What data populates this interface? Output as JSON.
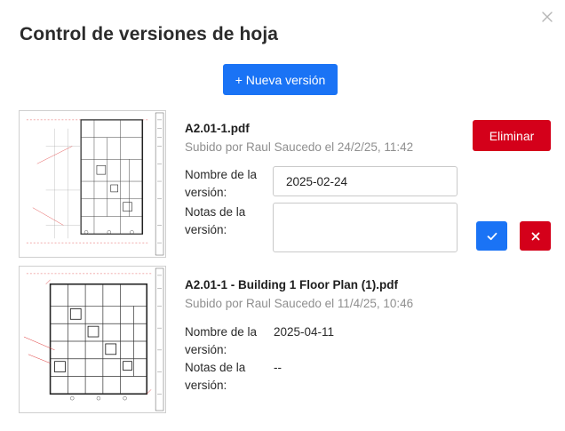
{
  "dialog": {
    "title": "Control de versiones de hoja",
    "new_version_label": "+ Nueva versión",
    "close_icon": "close-icon"
  },
  "versions": [
    {
      "filename": "A2.01-1.pdf",
      "uploaded": "Subido por Raul Saucedo el 24/2/25, 11:42",
      "name_label": "Nombre de la versión:",
      "name_value": "2025-02-24",
      "notes_label": "Notas de la versión:",
      "notes_value": "",
      "delete_label": "Eliminar",
      "editing": true
    },
    {
      "filename": "A2.01-1 - Building 1 Floor Plan (1).pdf",
      "uploaded": "Subido por Raul Saucedo el 11/4/25, 10:46",
      "name_label": "Nombre de la versión:",
      "name_value": "2025-04-11",
      "notes_label": "Notas de la versión:",
      "notes_value": "--",
      "editing": false
    }
  ],
  "colors": {
    "primary": "#1a73f5",
    "danger": "#d4001a",
    "muted_text": "#8f8f8f"
  }
}
